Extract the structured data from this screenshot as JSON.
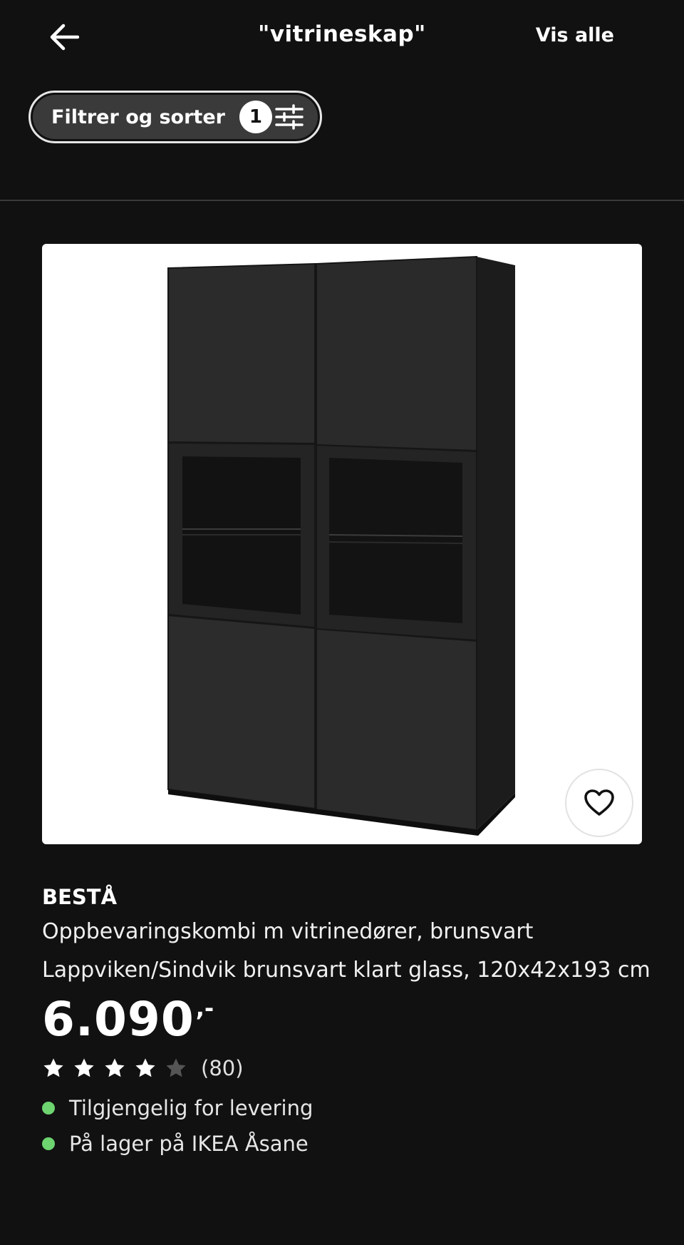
{
  "header": {
    "back_icon": "arrow-left-icon",
    "title": "\"vitrineskap\"",
    "vis_alle_label": "Vis alle"
  },
  "filter": {
    "label": "Filtrer og sorter",
    "count": "1",
    "icon": "sliders-icon"
  },
  "product": {
    "image_alt": "BESTÅ storage cabinet with glass doors",
    "favorite_icon": "heart-icon",
    "brand": "BESTÅ",
    "description": "Oppbevaringskombi m vitrinedører, brunsvart Lappviken/Sindvik brunsvart klart glass, 120x42x193 cm",
    "price": "6.090",
    "price_suffix": ",-",
    "rating": {
      "stars": 4,
      "max": 5,
      "count_label": "(80)"
    },
    "availability": [
      {
        "text": "Tilgjengelig for levering",
        "color": "#6dd46f"
      },
      {
        "text": "På lager på IKEA Åsane",
        "color": "#6dd46f"
      }
    ]
  },
  "colors": {
    "background": "#111111",
    "divider": "#3a3a3a",
    "pill": "#3a3a3a",
    "star_on": "#ffffff",
    "star_off": "#555555"
  }
}
